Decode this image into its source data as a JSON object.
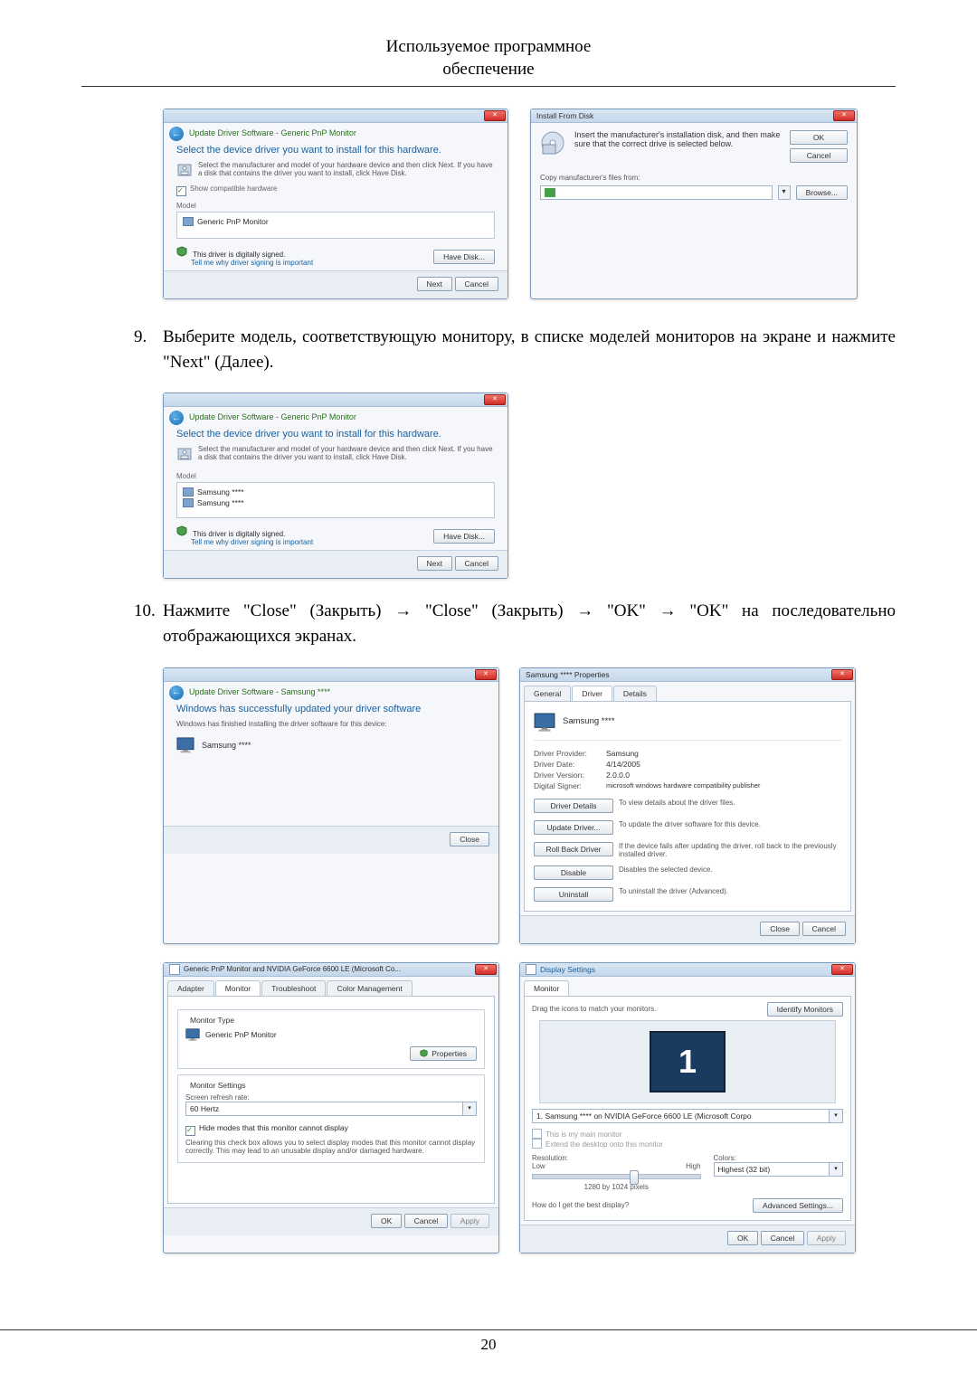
{
  "header": {
    "line1": "Используемое программное",
    "line2": "обеспечение"
  },
  "page_number": "20",
  "steps": {
    "s9": {
      "num": "9.",
      "text": "Выберите модель, соответствующую монитору, в списке моделей мониторов на экране и нажмите \"Next\" (Далее)."
    },
    "s10": {
      "num": "10.",
      "text": "Нажмите \"Close\" (Закрыть) → \"Close\" (Закрыть) → \"OK\" → \"OK\" на последовательно отображающихся экранах."
    }
  },
  "dlg1": {
    "crumb": "Update Driver Software - Generic PnP Monitor",
    "title": "Select the device driver you want to install for this hardware.",
    "sub": "Select the manufacturer and model of your hardware device and then click Next. If you have a disk that contains the driver you want to install, click Have Disk.",
    "show_compat": "Show compatible hardware",
    "model_label": "Model",
    "model1": "Generic PnP Monitor",
    "signed": "This driver is digitally signed.",
    "signed_link": "Tell me why driver signing is important",
    "have_disk": "Have Disk...",
    "next": "Next",
    "cancel": "Cancel"
  },
  "ifd": {
    "title": "Install From Disk",
    "msg": "Insert the manufacturer's installation disk, and then make sure that the correct drive is selected below.",
    "ok": "OK",
    "cancel": "Cancel",
    "copy_label": "Copy manufacturer's files from:",
    "browse": "Browse..."
  },
  "dlg2": {
    "crumb": "Update Driver Software - Generic PnP Monitor",
    "title": "Select the device driver you want to install for this hardware.",
    "sub": "Select the manufacturer and model of your hardware device and then click Next. If you have a disk that contains the driver you want to install, click Have Disk.",
    "model_label": "Model",
    "model1": "Samsung ****",
    "model2": "Samsung ****",
    "signed": "This driver is digitally signed.",
    "signed_link": "Tell me why driver signing is important",
    "have_disk": "Have Disk...",
    "next": "Next",
    "cancel": "Cancel"
  },
  "dlg3": {
    "crumb": "Update Driver Software - Samsung ****",
    "title": "Windows has successfully updated your driver software",
    "sub": "Windows has finished installing the driver software for this device:",
    "device": "Samsung ****",
    "close": "Close"
  },
  "prop": {
    "title": "Samsung **** Properties",
    "tabs": {
      "general": "General",
      "driver": "Driver",
      "details": "Details"
    },
    "device": "Samsung ****",
    "provider_k": "Driver Provider:",
    "provider_v": "Samsung",
    "date_k": "Driver Date:",
    "date_v": "4/14/2005",
    "ver_k": "Driver Version:",
    "ver_v": "2.0.0.0",
    "signer_k": "Digital Signer:",
    "signer_v": "microsoft windows hardware compatibility publisher",
    "b_details": "Driver Details",
    "d_details": "To view details about the driver files.",
    "b_update": "Update Driver...",
    "d_update": "To update the driver software for this device.",
    "b_roll": "Roll Back Driver",
    "d_roll": "If the device fails after updating the driver, roll back to the previously installed driver.",
    "b_disable": "Disable",
    "d_disable": "Disables the selected device.",
    "b_uninst": "Uninstall",
    "d_uninst": "To uninstall the driver (Advanced).",
    "close": "Close",
    "cancel": "Cancel"
  },
  "monprop": {
    "title": "Generic PnP Monitor and NVIDIA GeForce 6600 LE (Microsoft Co...",
    "tabs": {
      "adapter": "Adapter",
      "monitor": "Monitor",
      "troubleshoot": "Troubleshoot",
      "color": "Color Management"
    },
    "mtype": "Monitor Type",
    "mname": "Generic PnP Monitor",
    "props": "Properties",
    "mset": "Monitor Settings",
    "refresh_lbl": "Screen refresh rate:",
    "refresh_val": "60 Hertz",
    "hide": "Hide modes that this monitor cannot display",
    "hide_desc": "Clearing this check box allows you to select display modes that this monitor cannot display correctly. This may lead to an unusable display and/or damaged hardware.",
    "ok": "OK",
    "cancel": "Cancel",
    "apply": "Apply"
  },
  "ds": {
    "title": "Display Settings",
    "tab": "Monitor",
    "drag": "Drag the icons to match your monitors.",
    "identify": "Identify Monitors",
    "combo": "1. Samsung **** on NVIDIA GeForce 6600 LE (Microsoft Corpo",
    "main": "This is my main monitor",
    "extend": "Extend the desktop onto this monitor",
    "res_lbl": "Resolution:",
    "low": "Low",
    "high": "High",
    "res_val": "1280 by 1024 pixels",
    "col_lbl": "Colors:",
    "col_val": "Highest (32 bit)",
    "best": "How do I get the best display?",
    "adv": "Advanced Settings...",
    "ok": "OK",
    "cancel": "Cancel",
    "apply": "Apply"
  }
}
